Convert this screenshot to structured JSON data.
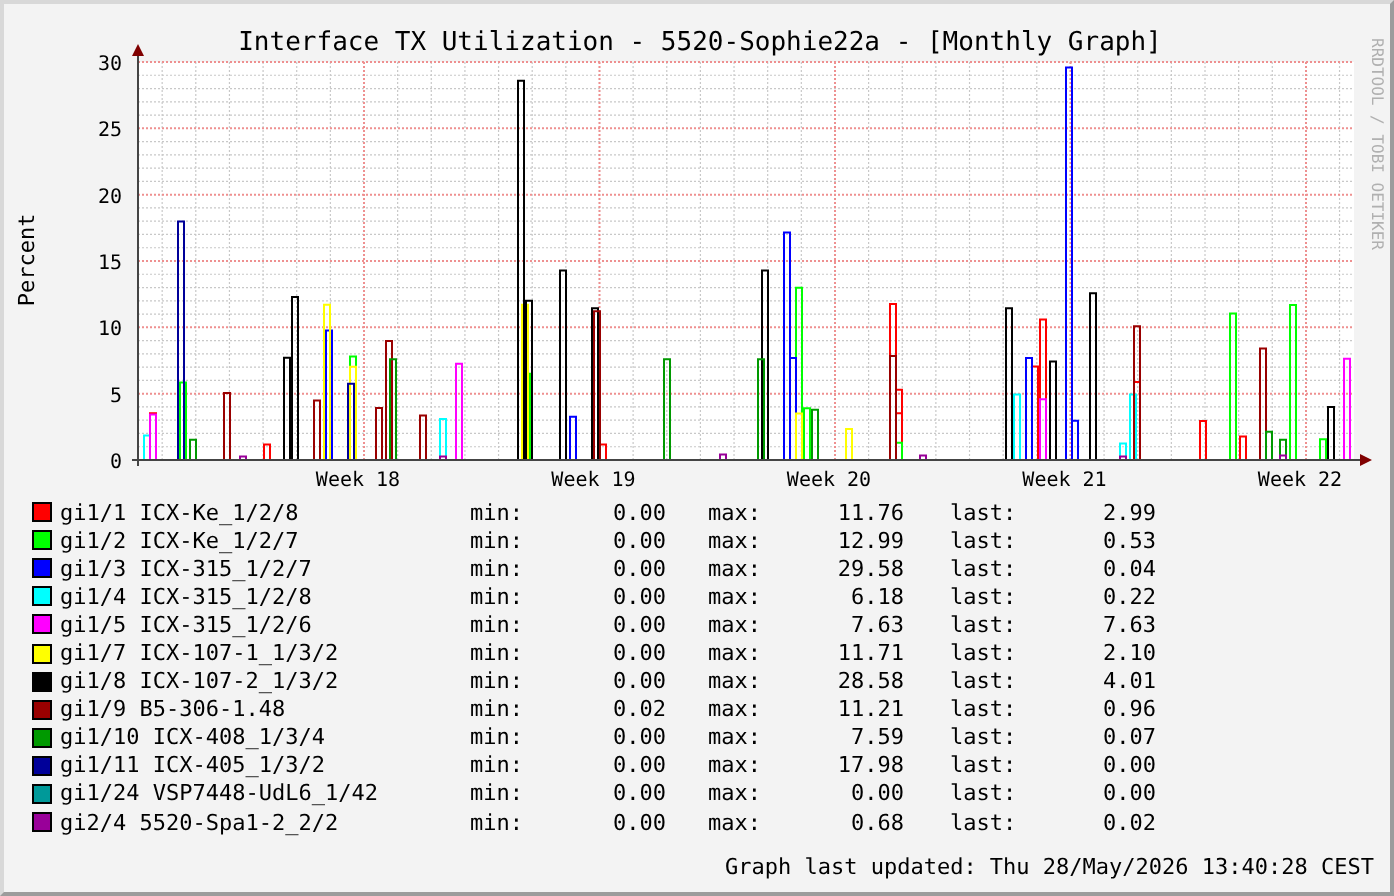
{
  "chart": {
    "title": "Interface TX Utilization - 5520-Sophie22a - [Monthly Graph]",
    "y_label": "Percent",
    "side_label": "RRDTOOL / TOBI OETIKER",
    "y_ticks": [
      "30",
      "25",
      "20",
      "15",
      "10",
      "5",
      "0"
    ],
    "x_ticks": [
      "Week 18",
      "Week 19",
      "Week 20",
      "Week 21",
      "Week 22"
    ]
  },
  "legend": [
    {
      "color": "#ff0000",
      "name": "gi1/1 ICX-Ke_1/2/8",
      "min_label": "min:",
      "min": "0.00",
      "max_label": "max:",
      "max": "11.76",
      "last_label": "last:",
      "last": "2.99"
    },
    {
      "color": "#00ff00",
      "name": "gi1/2 ICX-Ke_1/2/7",
      "min_label": "min:",
      "min": "0.00",
      "max_label": "max:",
      "max": "12.99",
      "last_label": "last:",
      "last": "0.53"
    },
    {
      "color": "#0000ff",
      "name": "gi1/3 ICX-315_1/2/7",
      "min_label": "min:",
      "min": "0.00",
      "max_label": "max:",
      "max": "29.58",
      "last_label": "last:",
      "last": "0.04"
    },
    {
      "color": "#00ffff",
      "name": "gi1/4 ICX-315_1/2/8",
      "min_label": "min:",
      "min": "0.00",
      "max_label": "max:",
      "max": "6.18",
      "last_label": "last:",
      "last": "0.22"
    },
    {
      "color": "#ff00ff",
      "name": "gi1/5 ICX-315_1/2/6",
      "min_label": "min:",
      "min": "0.00",
      "max_label": "max:",
      "max": "7.63",
      "last_label": "last:",
      "last": "7.63"
    },
    {
      "color": "#ffff00",
      "name": "gi1/7 ICX-107-1_1/3/2",
      "min_label": "min:",
      "min": "0.00",
      "max_label": "max:",
      "max": "11.71",
      "last_label": "last:",
      "last": "2.10"
    },
    {
      "color": "#000000",
      "name": "gi1/8 ICX-107-2_1/3/2",
      "min_label": "min:",
      "min": "0.00",
      "max_label": "max:",
      "max": "28.58",
      "last_label": "last:",
      "last": "4.01"
    },
    {
      "color": "#990000",
      "name": "gi1/9 B5-306-1.48",
      "min_label": "min:",
      "min": "0.02",
      "max_label": "max:",
      "max": "11.21",
      "last_label": "last:",
      "last": "0.96"
    },
    {
      "color": "#009900",
      "name": "gi1/10 ICX-408_1/3/4",
      "min_label": "min:",
      "min": "0.00",
      "max_label": "max:",
      "max": "7.59",
      "last_label": "last:",
      "last": "0.07"
    },
    {
      "color": "#000099",
      "name": "gi1/11 ICX-405_1/3/2",
      "min_label": "min:",
      "min": "0.00",
      "max_label": "max:",
      "max": "17.98",
      "last_label": "last:",
      "last": "0.00"
    },
    {
      "color": "#009999",
      "name": "gi1/24 VSP7448-UdL6_1/42",
      "min_label": "min:",
      "min": "0.00",
      "max_label": "max:",
      "max": "0.00",
      "last_label": "last:",
      "last": "0.00"
    },
    {
      "color": "#990099",
      "name": "gi2/4 5520-Spa1-2_2/2",
      "min_label": "min:",
      "min": "0.00",
      "max_label": "max:",
      "max": "0.68",
      "last_label": "last:",
      "last": "0.02"
    }
  ],
  "footer": "Graph last updated: Thu 28/May/2026 13:40:28 CEST"
}
